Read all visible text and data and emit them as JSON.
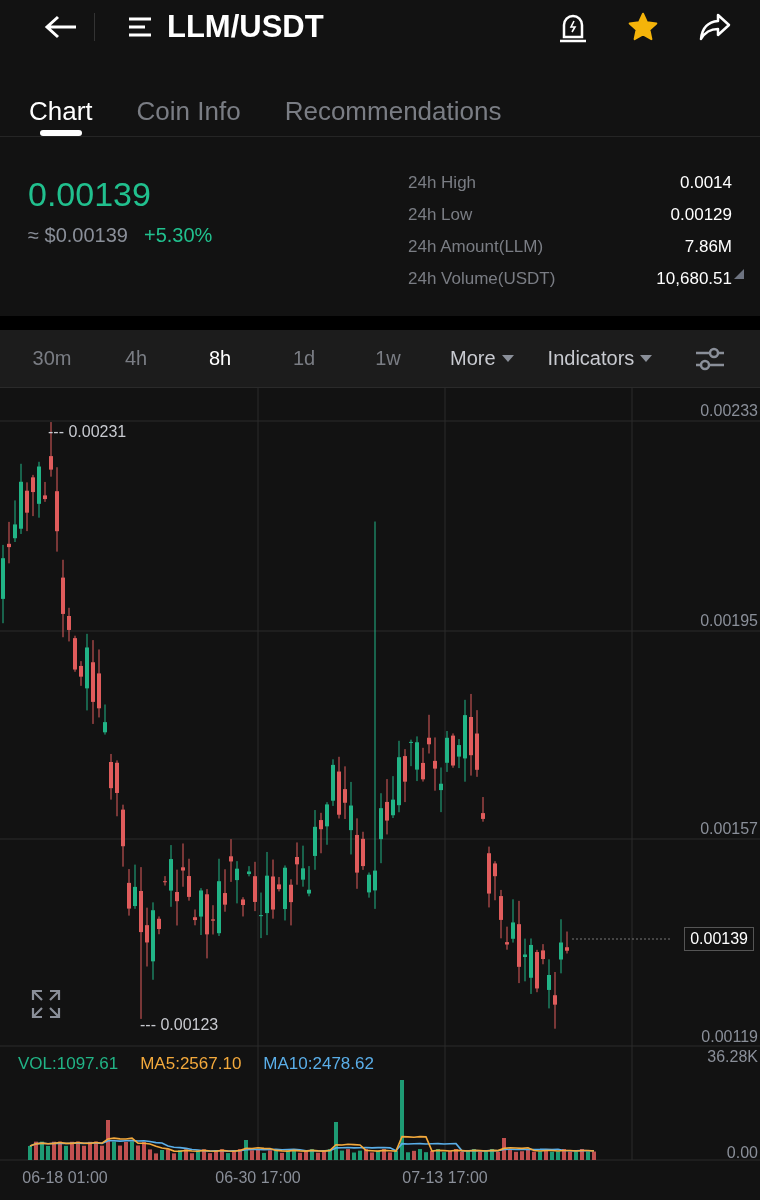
{
  "header": {
    "title": "LLM/USDT",
    "favorite": true
  },
  "tabs": [
    {
      "label": "Chart",
      "selected": true
    },
    {
      "label": "Coin Info",
      "selected": false
    },
    {
      "label": "Recommendations",
      "selected": false
    }
  ],
  "price": {
    "last": "0.00139",
    "fiat": "≈ $0.00139",
    "change": "+5.30%"
  },
  "stats": [
    {
      "label": "24h High",
      "value": "0.0014"
    },
    {
      "label": "24h Low",
      "value": "0.00129"
    },
    {
      "label": "24h Amount(LLM)",
      "value": "7.86M"
    },
    {
      "label": "24h Volume(USDT)",
      "value": "10,680.51"
    }
  ],
  "timeframes": [
    {
      "label": "30m",
      "selected": false
    },
    {
      "label": "4h",
      "selected": false
    },
    {
      "label": "8h",
      "selected": true
    },
    {
      "label": "1d",
      "selected": false
    },
    {
      "label": "1w",
      "selected": false
    }
  ],
  "dropdowns": [
    "More",
    "Indicators"
  ],
  "price_axis": [
    "0.00233",
    "0.00195",
    "0.00157",
    "0.00119"
  ],
  "high_marker": "--- 0.00231",
  "low_marker": "--- 0.00123",
  "current_price": "0.00139",
  "volume_legend": [
    {
      "text": "VOL:1097.61",
      "color": "#21b486"
    },
    {
      "text": "MA5:2567.10",
      "color": "#f3a93c"
    },
    {
      "text": "MA10:2478.62",
      "color": "#5aaee8"
    }
  ],
  "volume_axis": [
    "36.28K",
    "0.00"
  ],
  "time_axis": [
    "06-18 01:00",
    "06-30 17:00",
    "07-13 17:00"
  ]
}
